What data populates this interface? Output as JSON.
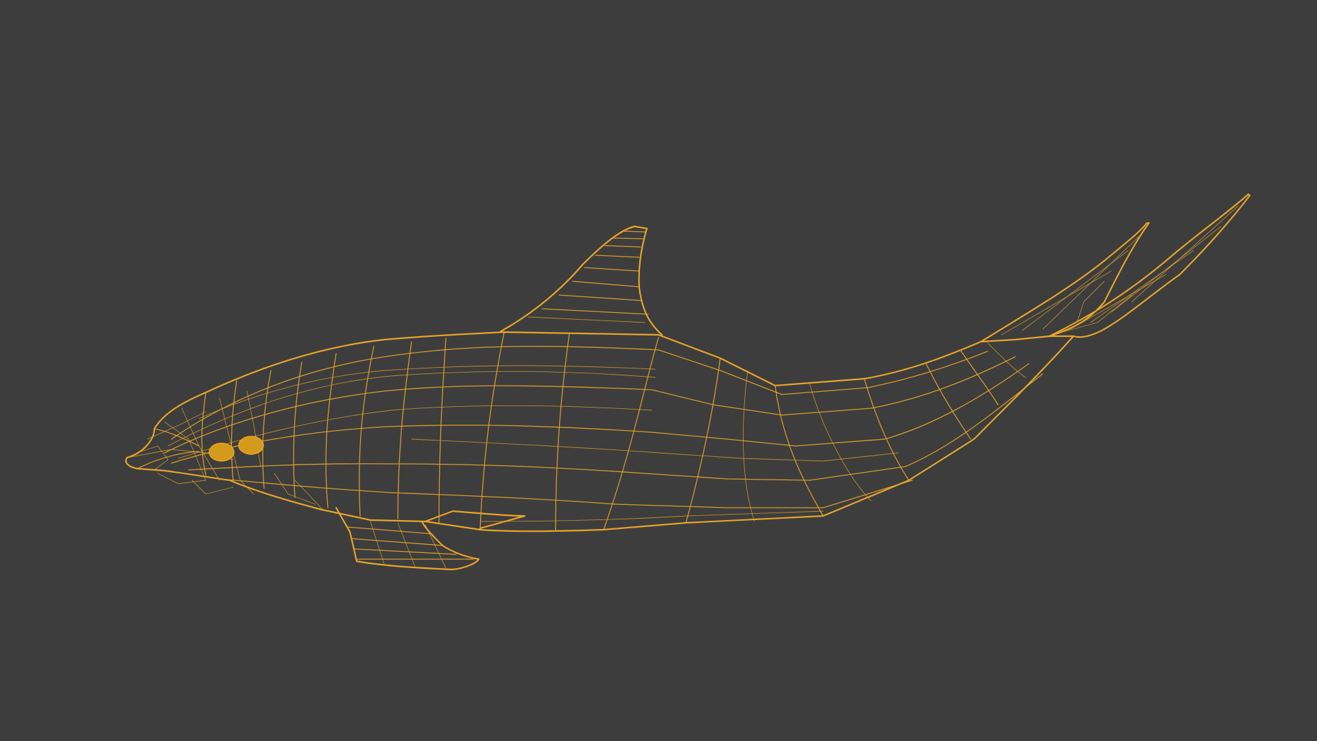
{
  "viewport": {
    "background_color": "#3d3d3d",
    "view_mode": "wireframe"
  },
  "model": {
    "subject": "dolphin",
    "wire_color": "#e8a52a",
    "eye_color": "#d49a1c",
    "selected": true
  }
}
